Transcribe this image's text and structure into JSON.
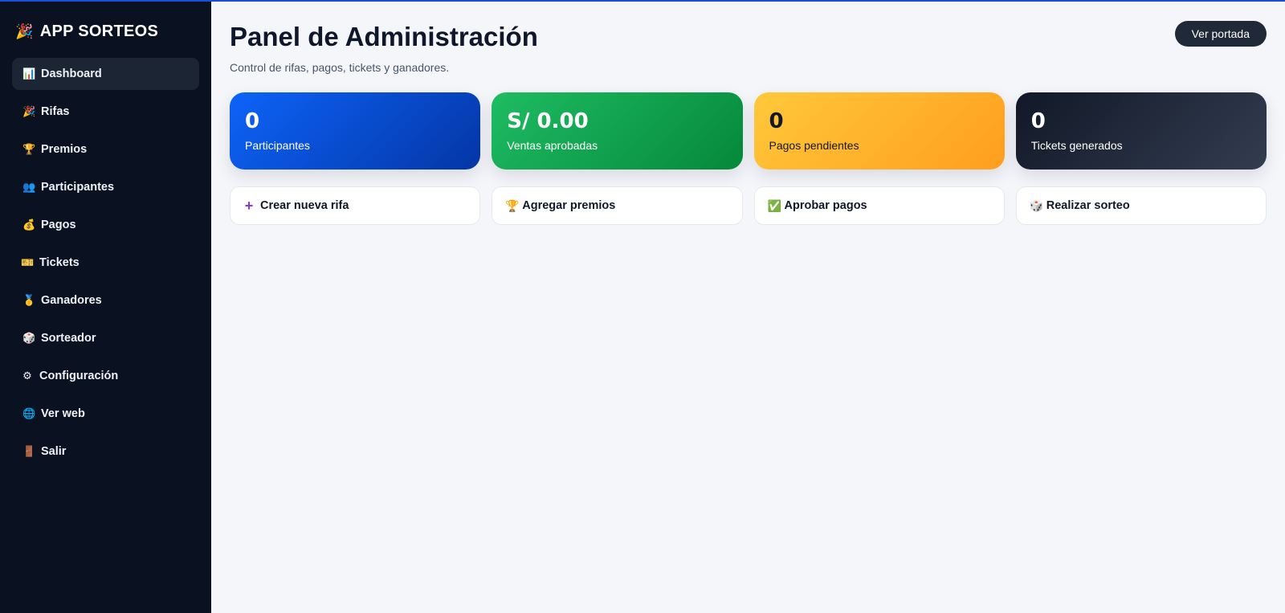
{
  "brand": {
    "icon": "party-popper-icon",
    "name": "APP SORTEOS"
  },
  "sidebar": {
    "items": [
      {
        "label": "Dashboard",
        "icon": "bar-chart-icon",
        "glyph": "📊",
        "active": true
      },
      {
        "label": "Rifas",
        "icon": "party-popper-icon",
        "glyph": "🎉"
      },
      {
        "label": "Premios",
        "icon": "trophy-icon",
        "glyph": "🏆"
      },
      {
        "label": "Participantes",
        "icon": "people-icon",
        "glyph": "👥"
      },
      {
        "label": "Pagos",
        "icon": "money-bag-icon",
        "glyph": "💰"
      },
      {
        "label": "Tickets",
        "icon": "ticket-icon",
        "glyph": "🎫"
      },
      {
        "label": "Ganadores",
        "icon": "medal-icon",
        "glyph": "🥇"
      },
      {
        "label": "Sorteador",
        "icon": "dice-icon",
        "glyph": "🎲"
      },
      {
        "label": "Configuración",
        "icon": "gear-icon",
        "glyph": "⚙"
      },
      {
        "label": "Ver web",
        "icon": "globe-icon",
        "glyph": "🌐"
      },
      {
        "label": "Salir",
        "icon": "door-icon",
        "glyph": "🚪"
      }
    ]
  },
  "header": {
    "title": "Panel de Administración",
    "subtitle": "Control de rifas, pagos, tickets y ganadores.",
    "portada_button": "Ver portada"
  },
  "stats": [
    {
      "value": "0",
      "label": "Participantes",
      "color": "#0d63f8"
    },
    {
      "value": "S/ 0.00",
      "label": "Ventas aprobadas",
      "color": "#1ebc63"
    },
    {
      "value": "0",
      "label": "Pagos pendientes",
      "color": "#ffb52b"
    },
    {
      "value": "0",
      "label": "Tickets generados",
      "color": "#111827"
    }
  ],
  "actions": [
    {
      "label": "Crear nueva rifa",
      "icon": "plus-icon",
      "glyph": "➕"
    },
    {
      "label": "Agregar premios",
      "icon": "trophy-icon",
      "glyph": "🏆"
    },
    {
      "label": "Aprobar pagos",
      "icon": "check-icon",
      "glyph": "✅"
    },
    {
      "label": "Realizar sorteo",
      "icon": "dice-icon",
      "glyph": "🎲"
    }
  ]
}
